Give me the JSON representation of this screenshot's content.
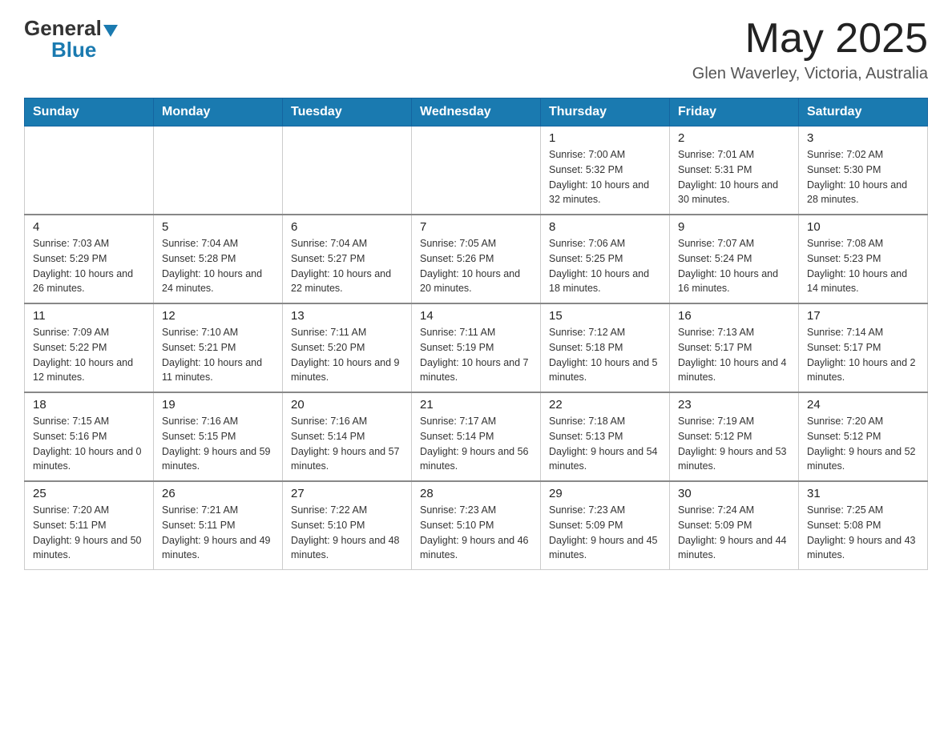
{
  "header": {
    "logo_general": "General",
    "logo_blue": "Blue",
    "month_title": "May 2025",
    "location": "Glen Waverley, Victoria, Australia"
  },
  "days_of_week": [
    "Sunday",
    "Monday",
    "Tuesday",
    "Wednesday",
    "Thursday",
    "Friday",
    "Saturday"
  ],
  "weeks": [
    [
      {
        "day": "",
        "sunrise": "",
        "sunset": "",
        "daylight": ""
      },
      {
        "day": "",
        "sunrise": "",
        "sunset": "",
        "daylight": ""
      },
      {
        "day": "",
        "sunrise": "",
        "sunset": "",
        "daylight": ""
      },
      {
        "day": "",
        "sunrise": "",
        "sunset": "",
        "daylight": ""
      },
      {
        "day": "1",
        "sunrise": "Sunrise: 7:00 AM",
        "sunset": "Sunset: 5:32 PM",
        "daylight": "Daylight: 10 hours and 32 minutes."
      },
      {
        "day": "2",
        "sunrise": "Sunrise: 7:01 AM",
        "sunset": "Sunset: 5:31 PM",
        "daylight": "Daylight: 10 hours and 30 minutes."
      },
      {
        "day": "3",
        "sunrise": "Sunrise: 7:02 AM",
        "sunset": "Sunset: 5:30 PM",
        "daylight": "Daylight: 10 hours and 28 minutes."
      }
    ],
    [
      {
        "day": "4",
        "sunrise": "Sunrise: 7:03 AM",
        "sunset": "Sunset: 5:29 PM",
        "daylight": "Daylight: 10 hours and 26 minutes."
      },
      {
        "day": "5",
        "sunrise": "Sunrise: 7:04 AM",
        "sunset": "Sunset: 5:28 PM",
        "daylight": "Daylight: 10 hours and 24 minutes."
      },
      {
        "day": "6",
        "sunrise": "Sunrise: 7:04 AM",
        "sunset": "Sunset: 5:27 PM",
        "daylight": "Daylight: 10 hours and 22 minutes."
      },
      {
        "day": "7",
        "sunrise": "Sunrise: 7:05 AM",
        "sunset": "Sunset: 5:26 PM",
        "daylight": "Daylight: 10 hours and 20 minutes."
      },
      {
        "day": "8",
        "sunrise": "Sunrise: 7:06 AM",
        "sunset": "Sunset: 5:25 PM",
        "daylight": "Daylight: 10 hours and 18 minutes."
      },
      {
        "day": "9",
        "sunrise": "Sunrise: 7:07 AM",
        "sunset": "Sunset: 5:24 PM",
        "daylight": "Daylight: 10 hours and 16 minutes."
      },
      {
        "day": "10",
        "sunrise": "Sunrise: 7:08 AM",
        "sunset": "Sunset: 5:23 PM",
        "daylight": "Daylight: 10 hours and 14 minutes."
      }
    ],
    [
      {
        "day": "11",
        "sunrise": "Sunrise: 7:09 AM",
        "sunset": "Sunset: 5:22 PM",
        "daylight": "Daylight: 10 hours and 12 minutes."
      },
      {
        "day": "12",
        "sunrise": "Sunrise: 7:10 AM",
        "sunset": "Sunset: 5:21 PM",
        "daylight": "Daylight: 10 hours and 11 minutes."
      },
      {
        "day": "13",
        "sunrise": "Sunrise: 7:11 AM",
        "sunset": "Sunset: 5:20 PM",
        "daylight": "Daylight: 10 hours and 9 minutes."
      },
      {
        "day": "14",
        "sunrise": "Sunrise: 7:11 AM",
        "sunset": "Sunset: 5:19 PM",
        "daylight": "Daylight: 10 hours and 7 minutes."
      },
      {
        "day": "15",
        "sunrise": "Sunrise: 7:12 AM",
        "sunset": "Sunset: 5:18 PM",
        "daylight": "Daylight: 10 hours and 5 minutes."
      },
      {
        "day": "16",
        "sunrise": "Sunrise: 7:13 AM",
        "sunset": "Sunset: 5:17 PM",
        "daylight": "Daylight: 10 hours and 4 minutes."
      },
      {
        "day": "17",
        "sunrise": "Sunrise: 7:14 AM",
        "sunset": "Sunset: 5:17 PM",
        "daylight": "Daylight: 10 hours and 2 minutes."
      }
    ],
    [
      {
        "day": "18",
        "sunrise": "Sunrise: 7:15 AM",
        "sunset": "Sunset: 5:16 PM",
        "daylight": "Daylight: 10 hours and 0 minutes."
      },
      {
        "day": "19",
        "sunrise": "Sunrise: 7:16 AM",
        "sunset": "Sunset: 5:15 PM",
        "daylight": "Daylight: 9 hours and 59 minutes."
      },
      {
        "day": "20",
        "sunrise": "Sunrise: 7:16 AM",
        "sunset": "Sunset: 5:14 PM",
        "daylight": "Daylight: 9 hours and 57 minutes."
      },
      {
        "day": "21",
        "sunrise": "Sunrise: 7:17 AM",
        "sunset": "Sunset: 5:14 PM",
        "daylight": "Daylight: 9 hours and 56 minutes."
      },
      {
        "day": "22",
        "sunrise": "Sunrise: 7:18 AM",
        "sunset": "Sunset: 5:13 PM",
        "daylight": "Daylight: 9 hours and 54 minutes."
      },
      {
        "day": "23",
        "sunrise": "Sunrise: 7:19 AM",
        "sunset": "Sunset: 5:12 PM",
        "daylight": "Daylight: 9 hours and 53 minutes."
      },
      {
        "day": "24",
        "sunrise": "Sunrise: 7:20 AM",
        "sunset": "Sunset: 5:12 PM",
        "daylight": "Daylight: 9 hours and 52 minutes."
      }
    ],
    [
      {
        "day": "25",
        "sunrise": "Sunrise: 7:20 AM",
        "sunset": "Sunset: 5:11 PM",
        "daylight": "Daylight: 9 hours and 50 minutes."
      },
      {
        "day": "26",
        "sunrise": "Sunrise: 7:21 AM",
        "sunset": "Sunset: 5:11 PM",
        "daylight": "Daylight: 9 hours and 49 minutes."
      },
      {
        "day": "27",
        "sunrise": "Sunrise: 7:22 AM",
        "sunset": "Sunset: 5:10 PM",
        "daylight": "Daylight: 9 hours and 48 minutes."
      },
      {
        "day": "28",
        "sunrise": "Sunrise: 7:23 AM",
        "sunset": "Sunset: 5:10 PM",
        "daylight": "Daylight: 9 hours and 46 minutes."
      },
      {
        "day": "29",
        "sunrise": "Sunrise: 7:23 AM",
        "sunset": "Sunset: 5:09 PM",
        "daylight": "Daylight: 9 hours and 45 minutes."
      },
      {
        "day": "30",
        "sunrise": "Sunrise: 7:24 AM",
        "sunset": "Sunset: 5:09 PM",
        "daylight": "Daylight: 9 hours and 44 minutes."
      },
      {
        "day": "31",
        "sunrise": "Sunrise: 7:25 AM",
        "sunset": "Sunset: 5:08 PM",
        "daylight": "Daylight: 9 hours and 43 minutes."
      }
    ]
  ]
}
